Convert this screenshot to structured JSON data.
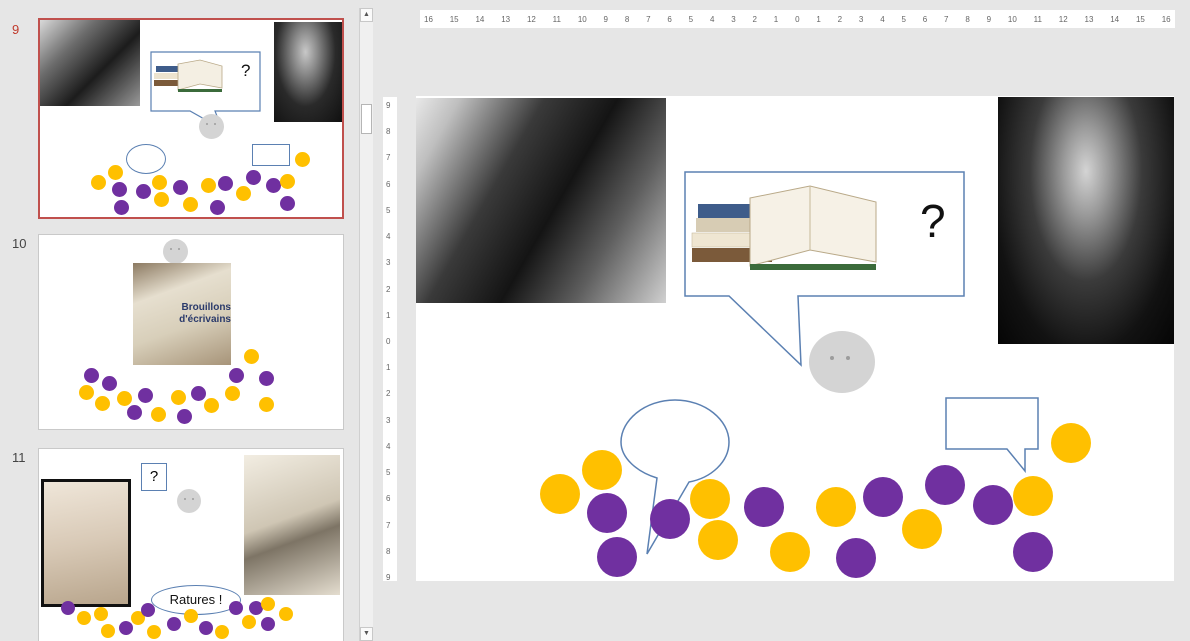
{
  "thumbnails": [
    {
      "number": "9",
      "selected": true
    },
    {
      "number": "10",
      "selected": false,
      "title_line1": "Brouillons",
      "title_line2": "d'écrivains"
    },
    {
      "number": "11",
      "selected": false,
      "question": "?",
      "caption": "Ratures !"
    }
  ],
  "slide": {
    "question": "?"
  },
  "ruler": {
    "horizontal": [
      "16",
      "15",
      "14",
      "13",
      "12",
      "11",
      "10",
      "9",
      "8",
      "7",
      "6",
      "5",
      "4",
      "3",
      "2",
      "1",
      "0",
      "1",
      "2",
      "3",
      "4",
      "5",
      "6",
      "7",
      "8",
      "9",
      "10",
      "11",
      "12",
      "13",
      "14",
      "15",
      "16"
    ],
    "vertical": [
      "9",
      "8",
      "7",
      "6",
      "5",
      "4",
      "3",
      "2",
      "1",
      "0",
      "1",
      "2",
      "3",
      "4",
      "5",
      "6",
      "7",
      "8",
      "9"
    ]
  },
  "colors": {
    "yellow_dot": "#ffc000",
    "purple_dot": "#7030a0",
    "bubble_border": "#5b80b2",
    "selected_border": "#c0504d"
  }
}
